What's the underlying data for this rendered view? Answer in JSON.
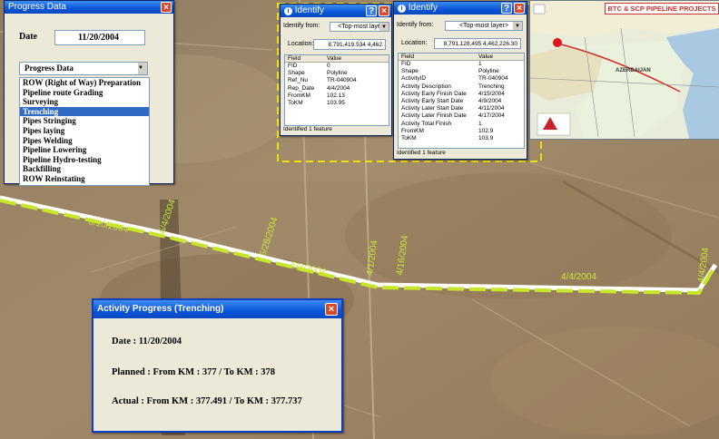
{
  "colors": {
    "route_line": "#ffffff",
    "progress_dash": "#c6e62a",
    "label": "#c8e636",
    "highlight_border": "#f0e000"
  },
  "progress_window": {
    "title": "Progress Data",
    "date_label": "Date",
    "date_value": "11/20/2004",
    "dropdown_selected": "Progress Data",
    "items": [
      "ROW (Right of Way) Preparation",
      "Pipeline route Grading",
      "Surveying",
      "Trenching",
      "Pipes Stringing",
      "Pipes laying",
      "Pipes Welding",
      "Pipeline Lowering",
      "Pipeline Hydro-testing",
      "Backfilling",
      "ROW Reinstating"
    ],
    "selected_index": 3
  },
  "identify1": {
    "title": "Identify",
    "from_label": "Identify from:",
    "from_value": "<Top-most laye",
    "location_label": "Location:",
    "location_value": "8,791,419.534  4,462",
    "header_field": "Field",
    "header_value": "Value",
    "rows": [
      [
        "FID",
        "0"
      ],
      [
        "Shape",
        "Polyline"
      ],
      [
        "Ref_Nu",
        "TR-040904"
      ],
      [
        "Rep_Date",
        "4/4/2004"
      ],
      [
        "FromKM",
        "102.13"
      ],
      [
        "ToKM",
        "103.95"
      ]
    ],
    "status": "Identified 1 feature"
  },
  "identify2": {
    "title": "Identify",
    "from_label": "Identify from:",
    "from_value": "<Top-most layer>",
    "location_label": "Location:",
    "location_value": "8,791,128.495  4,462,226.30",
    "header_field": "Field",
    "header_value": "Value",
    "rows": [
      [
        "FID",
        "1"
      ],
      [
        "Shape",
        "Polyline"
      ],
      [
        "ActivityID",
        "TR-040904"
      ],
      [
        "Activity Description",
        "Trenching"
      ],
      [
        "Activity Early Finish Date",
        "4/15/2004"
      ],
      [
        "Activity Early Start Date",
        "4/9/2004"
      ],
      [
        "Activity Later Start Date",
        "4/11/2004"
      ],
      [
        "Activity Later Finish Date",
        "4/17/2004"
      ],
      [
        "Activity Total Finish",
        "1"
      ],
      [
        "FromKM",
        "102.9"
      ],
      [
        "ToKM",
        "103.9"
      ]
    ],
    "status": "Identified 1 feature"
  },
  "map": {
    "title": "BTC & SCP PIPELINE PROJECTS",
    "country": "AZERBAIJAN"
  },
  "route_labels": [
    "6/10/2004",
    "6/4/2004",
    "5/28/2004",
    "5/3/2004",
    "4/1/2004",
    "4/16/2004",
    "4/4/2004",
    "4/4/2004"
  ],
  "activity_window": {
    "title": "Activity Progress (Trenching)",
    "date": "Date : 11/20/2004",
    "planned": "Planned : From KM : 377 / To KM : 378",
    "actual": "Actual : From KM : 377.491 / To KM : 377.737"
  }
}
